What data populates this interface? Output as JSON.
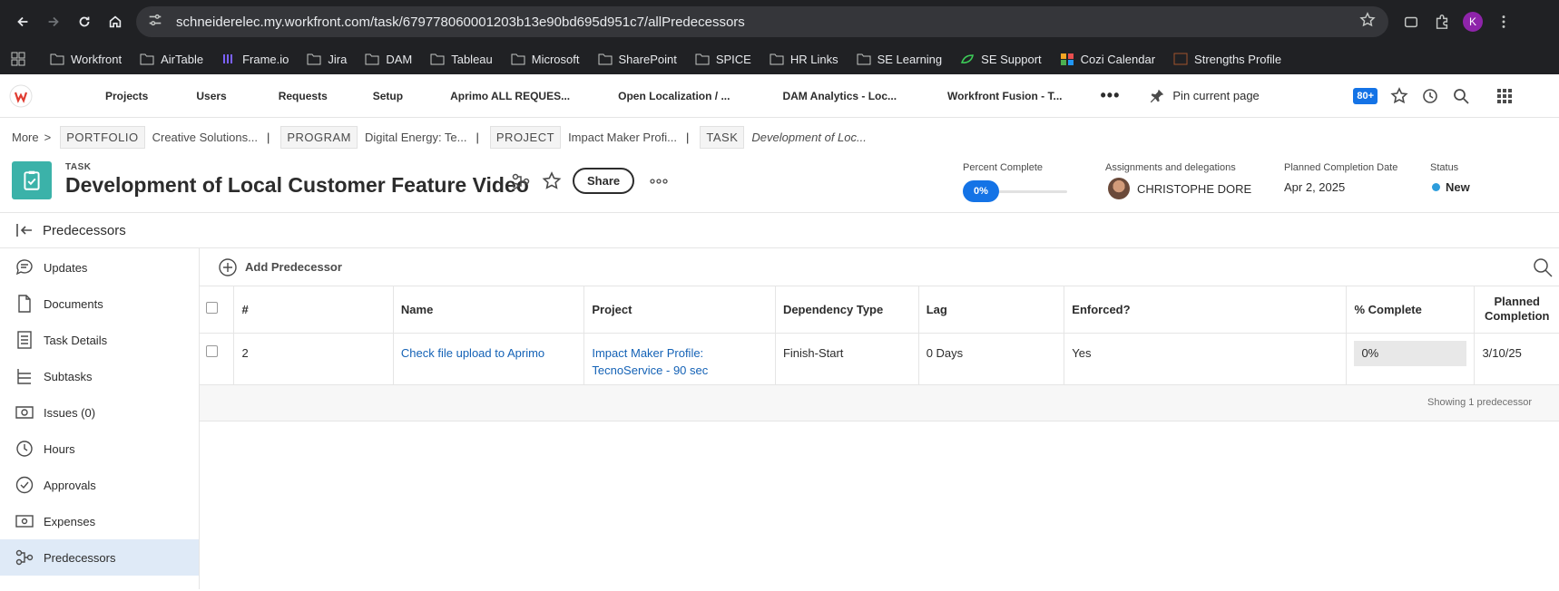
{
  "browser": {
    "url": "schneiderelec.my.workfront.com/task/679778060001203b13e90bd695d951c7/allPredecessors",
    "profile_initial": "K",
    "bookmarks": [
      "Workfront",
      "AirTable",
      "Frame.io",
      "Jira",
      "DAM",
      "Tableau",
      "Microsoft",
      "SharePoint",
      "SPICE",
      "HR Links",
      "SE Learning",
      "SE Support",
      "Cozi Calendar",
      "Strengths Profile"
    ]
  },
  "topnav": {
    "links": [
      "Projects",
      "Users",
      "Requests",
      "Setup",
      "Aprimo ALL REQUES...",
      "Open Localization / ...",
      "DAM Analytics - Loc...",
      "Workfront Fusion - T..."
    ],
    "pin_label": "Pin current page",
    "notifications": "80+"
  },
  "breadcrumb": {
    "more": "More",
    "items": [
      {
        "tag": "PORTFOLIO",
        "value": "Creative Solutions..."
      },
      {
        "tag": "PROGRAM",
        "value": "Digital Energy: Te..."
      },
      {
        "tag": "PROJECT",
        "value": "Impact Maker Profi..."
      },
      {
        "tag": "TASK",
        "value": "Development of Loc..."
      }
    ]
  },
  "task": {
    "type_label": "TASK",
    "title": "Development of Local Customer Feature Video",
    "share_label": "Share",
    "percent_label": "Percent Complete",
    "percent_value": "0%",
    "assign_label": "Assignments and delegations",
    "assignee": "CHRISTOPHE DORE",
    "planned_label": "Planned Completion Date",
    "planned_value": "Apr 2, 2025",
    "status_label": "Status",
    "status_value": "New"
  },
  "section": {
    "title": "Predecessors"
  },
  "sidebar": {
    "items": [
      "Updates",
      "Documents",
      "Task Details",
      "Subtasks",
      "Issues (0)",
      "Hours",
      "Approvals",
      "Expenses",
      "Predecessors"
    ]
  },
  "toolbar": {
    "add_label": "Add Predecessor"
  },
  "table": {
    "headers": [
      "#",
      "Name",
      "Project",
      "Dependency Type",
      "Lag",
      "Enforced?",
      "% Complete",
      "Planned Completion"
    ],
    "rows": [
      {
        "num": "2",
        "name": "Check file upload to Aprimo",
        "project": "Impact Maker Profile: TecnoService - 90 sec",
        "dependency": "Finish-Start",
        "lag": "0 Days",
        "enforced": "Yes",
        "complete": "0%",
        "planned": "3/10/25"
      }
    ],
    "footer": "Showing 1 predecessor"
  }
}
